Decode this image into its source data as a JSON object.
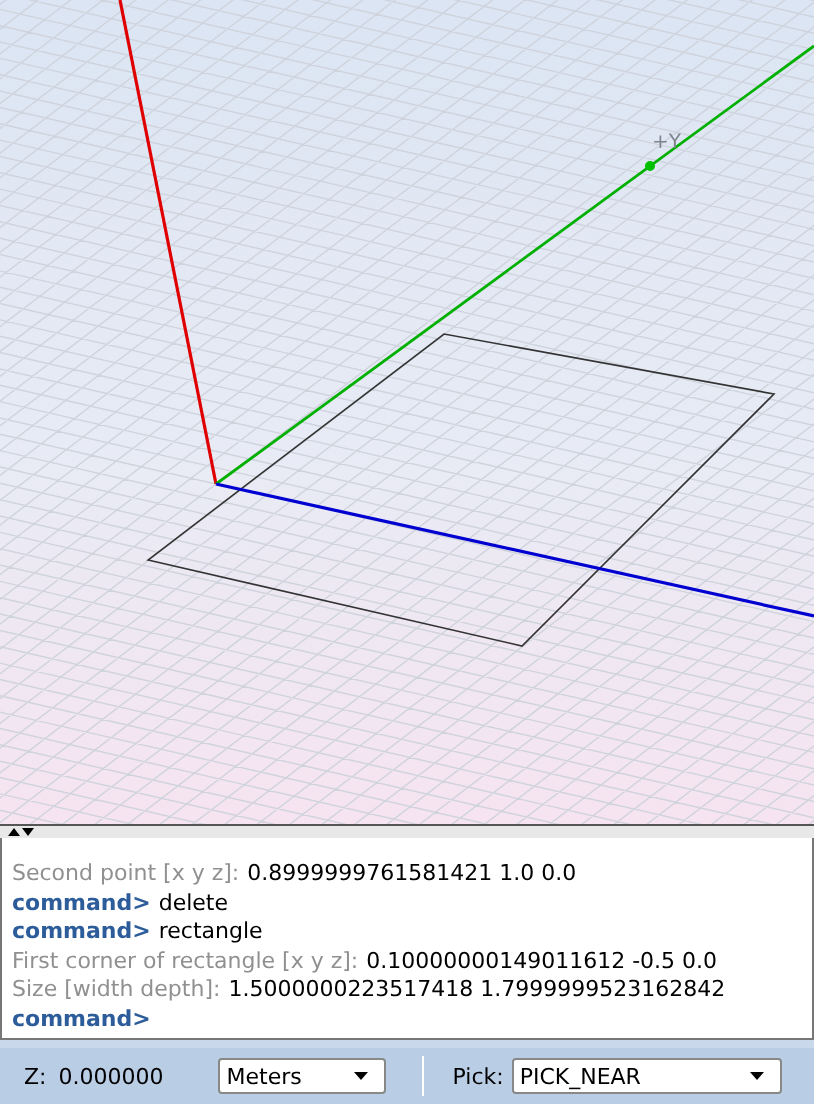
{
  "viewport": {
    "axis_label": "+Y"
  },
  "console": {
    "lines": [
      {
        "kind": "output",
        "prompt": "Second point [x y z]:",
        "value": "0.8999999761581421 1.0 0.0"
      },
      {
        "kind": "command",
        "prompt": "command>",
        "value": "delete"
      },
      {
        "kind": "command",
        "prompt": "command>",
        "value": "rectangle"
      },
      {
        "kind": "output",
        "prompt": "First corner of rectangle [x y z]:",
        "value": "0.10000000149011612 -0.5 0.0"
      },
      {
        "kind": "output",
        "prompt": "Size [width depth]:",
        "value": "1.5000000223517418 1.7999999523162842"
      },
      {
        "kind": "command",
        "prompt": "command>"
      }
    ]
  },
  "status_bar": {
    "z_label": "Z:",
    "z_value": "0.000000",
    "units": "Meters",
    "pick_label": "Pick:",
    "pick": "PICK_NEAR"
  }
}
